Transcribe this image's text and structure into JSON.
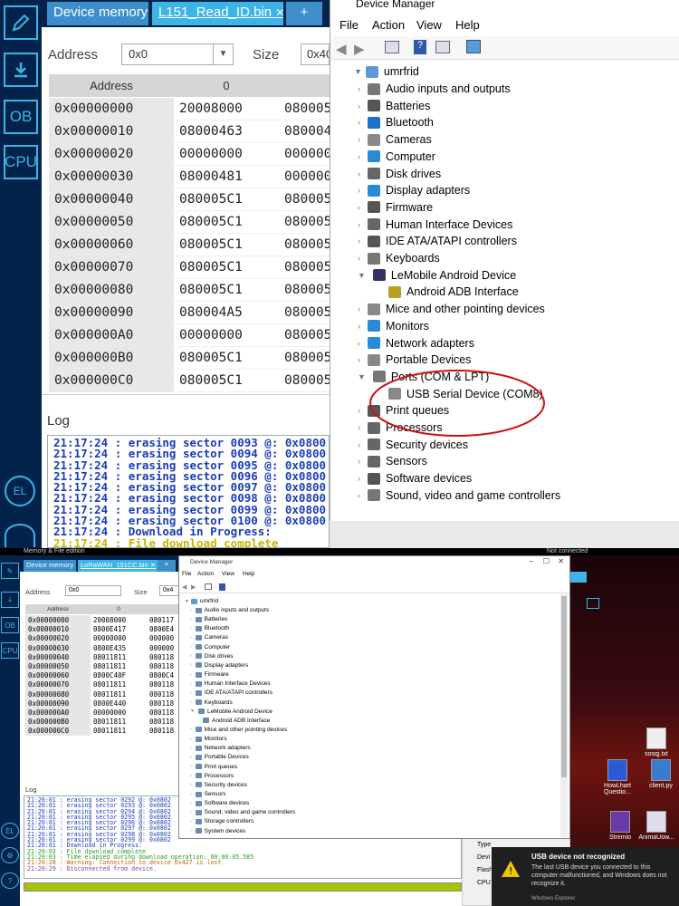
{
  "top": {
    "stm": {
      "tabs": [
        "Device memory",
        "L151_Read_ID.bin",
        "+"
      ],
      "address_label": "Address",
      "address_value": "0x0",
      "size_label": "Size",
      "size_value": "0x40",
      "col_address": "Address",
      "col_0": "0",
      "rows": [
        [
          "0x00000000",
          "20008000",
          "080005"
        ],
        [
          "0x00000010",
          "08000463",
          "080004"
        ],
        [
          "0x00000020",
          "00000000",
          "000000"
        ],
        [
          "0x00000030",
          "08000481",
          "000000"
        ],
        [
          "0x00000040",
          "080005C1",
          "080005"
        ],
        [
          "0x00000050",
          "080005C1",
          "080005"
        ],
        [
          "0x00000060",
          "080005C1",
          "080005"
        ],
        [
          "0x00000070",
          "080005C1",
          "080005"
        ],
        [
          "0x00000080",
          "080005C1",
          "080005"
        ],
        [
          "0x00000090",
          "080004A5",
          "080005"
        ],
        [
          "0x000000A0",
          "00000000",
          "080005"
        ],
        [
          "0x000000B0",
          "080005C1",
          "080005"
        ],
        [
          "0x000000C0",
          "080005C1",
          "080005"
        ]
      ],
      "log_title": "Log",
      "log_lines": [
        "21:17:24 : erasing sector 0093 @: 0x0800",
        "21:17:24 : erasing sector 0094 @: 0x0800",
        "21:17:24 : erasing sector 0095 @: 0x0800",
        "21:17:24 : erasing sector 0096 @: 0x0800",
        "21:17:24 : erasing sector 0097 @: 0x0800",
        "21:17:24 : erasing sector 0098 @: 0x0800",
        "21:17:24 : erasing sector 0099 @: 0x0800",
        "21:17:24 : erasing sector 0100 @: 0x0800",
        "21:17:24 : Download in Progress:",
        "21:17:24 : File download complete"
      ]
    },
    "dm": {
      "title": "Device Manager",
      "menu": [
        "File",
        "Action",
        "View",
        "Help"
      ],
      "root": "umrfrid",
      "items": [
        "Audio inputs and outputs",
        "Batteries",
        "Bluetooth",
        "Cameras",
        "Computer",
        "Disk drives",
        "Display adapters",
        "Firmware",
        "Human Interface Devices",
        "IDE ATA/ATAPI controllers",
        "Keyboards",
        "LeMobile Android Device",
        "Android ADB Interface",
        "Mice and other pointing devices",
        "Monitors",
        "Network adapters",
        "Portable Devices",
        "Ports (COM & LPT)",
        "USB Serial Device (COM8)",
        "Print queues",
        "Processors",
        "Security devices",
        "Sensors",
        "Software devices",
        "Sound, video and game controllers"
      ]
    }
  },
  "bottom": {
    "app_title": "Memory & File edition",
    "not_connected": "Not connected",
    "stm": {
      "tabs": [
        "Device memory",
        "LoRaWAN_151CC.bin",
        "+"
      ],
      "address_label": "Address",
      "address_value": "0x0",
      "size_label": "Size",
      "size_value": "0x4",
      "col_address": "Address",
      "col_0": "0",
      "rows": [
        [
          "0x00000000",
          "20008000",
          "080117"
        ],
        [
          "0x00000010",
          "0800E417",
          "0800E4"
        ],
        [
          "0x00000020",
          "00000000",
          "000000"
        ],
        [
          "0x00000030",
          "0800E435",
          "000000"
        ],
        [
          "0x00000040",
          "08011811",
          "080118"
        ],
        [
          "0x00000050",
          "08011811",
          "080118"
        ],
        [
          "0x00000060",
          "0800C40F",
          "0800C4"
        ],
        [
          "0x00000070",
          "08011811",
          "080118"
        ],
        [
          "0x00000080",
          "08011811",
          "080118"
        ],
        [
          "0x00000090",
          "0800E440",
          "080118"
        ],
        [
          "0x000000A0",
          "00000000",
          "080118"
        ],
        [
          "0x000000B0",
          "08011811",
          "080118"
        ],
        [
          "0x000000C0",
          "08011811",
          "080118"
        ]
      ],
      "log_title": "Log",
      "log_lines": [
        "21:20:01 : erasing sector 0292 @: 0x0802",
        "21:20:01 : erasing sector 0293 @: 0x0802",
        "21:20:01 : erasing sector 0294 @: 0x0802",
        "21:20:01 : erasing sector 0295 @: 0x0802",
        "21:20:01 : erasing sector 0296 @: 0x0802",
        "21:20:01 : erasing sector 0297 @: 0x0802",
        "21:20:01 : erasing sector 0298 @: 0x0802",
        "21:20:01 : erasing sector 0299 @: 0x0802",
        "21:20:01 : Download in Progress:",
        "21:20:03 : File download complete",
        "21:20:03 : Time elapsed during download operation: 00:00:05.585",
        "21:20:28 : Warning: Connection to device 0x427 is lost",
        "21:20:29 : Disconnected from device."
      ]
    },
    "dm": {
      "title": "Device Manager",
      "menu": [
        "File",
        "Action",
        "View",
        "Help"
      ],
      "root": "umrfrid",
      "items": [
        "Audio inputs and outputs",
        "Batteries",
        "Bluetooth",
        "Cameras",
        "Computer",
        "Disk drives",
        "Display adapters",
        "Firmware",
        "Human Interface Devices",
        "IDE ATA/ATAPI controllers",
        "Keyboards",
        "LeMobile Android Device",
        "Android ADB Interface",
        "Mice and other pointing devices",
        "Monitors",
        "Network adapters",
        "Portable Devices",
        "Print queues",
        "Processors",
        "Security devices",
        "Sensors",
        "Software devices",
        "Sound, video and game controllers",
        "Storage controllers",
        "System devices"
      ]
    },
    "side_labels": [
      "Type",
      "Devi",
      "Flash",
      "CPU"
    ],
    "desktop_icons": [
      "sosqj.txt",
      "HowLhart Questio...",
      "client.py",
      "Stremio",
      "AnimaUow..."
    ],
    "toast": {
      "title": "USB device not recognized",
      "body": "The last USB device you connected to this computer malfunctioned, and Windows does not recognize it.",
      "source": "Windows Explorer"
    }
  },
  "colors": {
    "stm_dark": "#03234b",
    "stm_accent": "#3cb4e6",
    "log_blue": "#1a3db8",
    "log_yellow": "#c8b400",
    "circle_red": "#cc1111"
  },
  "sidebar_icons": [
    "pencil-icon",
    "download-icon",
    "ob-icon",
    "cpu-icon",
    "el-icon",
    "tools-icon"
  ]
}
